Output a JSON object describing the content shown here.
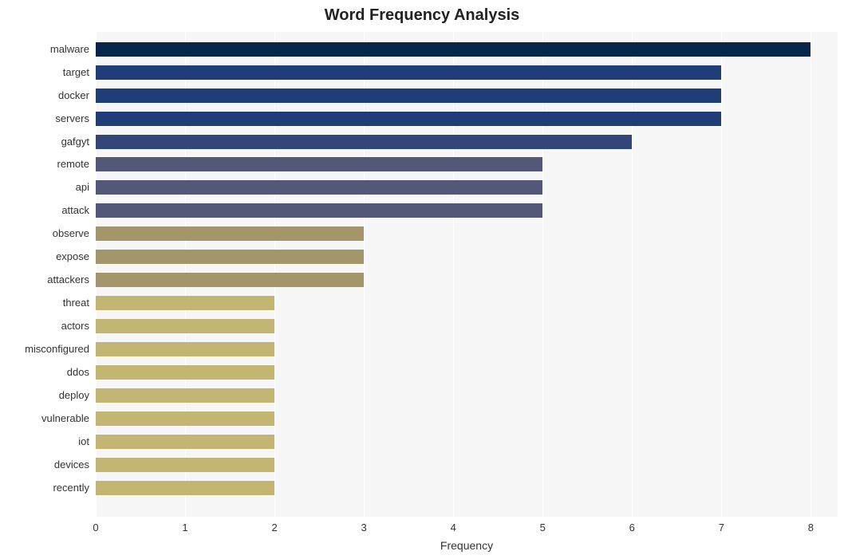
{
  "chart_data": {
    "type": "bar",
    "orientation": "horizontal",
    "title": "Word Frequency Analysis",
    "xlabel": "Frequency",
    "ylabel": "",
    "xlim": [
      0,
      8.3
    ],
    "xticks": [
      0,
      1,
      2,
      3,
      4,
      5,
      6,
      7,
      8
    ],
    "categories": [
      "malware",
      "target",
      "docker",
      "servers",
      "gafgyt",
      "remote",
      "api",
      "attack",
      "observe",
      "expose",
      "attackers",
      "threat",
      "actors",
      "misconfigured",
      "ddos",
      "deploy",
      "vulnerable",
      "iot",
      "devices",
      "recently"
    ],
    "values": [
      8,
      7,
      7,
      7,
      6,
      5,
      5,
      5,
      3,
      3,
      3,
      2,
      2,
      2,
      2,
      2,
      2,
      2,
      2,
      2
    ],
    "colors": [
      "#06264c",
      "#1f3d77",
      "#1f3d77",
      "#1f3d77",
      "#324778",
      "#535879",
      "#535879",
      "#535879",
      "#a3966b",
      "#a3966b",
      "#a3966b",
      "#c3b672",
      "#c3b672",
      "#c3b672",
      "#c3b672",
      "#c3b672",
      "#c3b672",
      "#c3b672",
      "#c3b672",
      "#c3b672"
    ]
  }
}
